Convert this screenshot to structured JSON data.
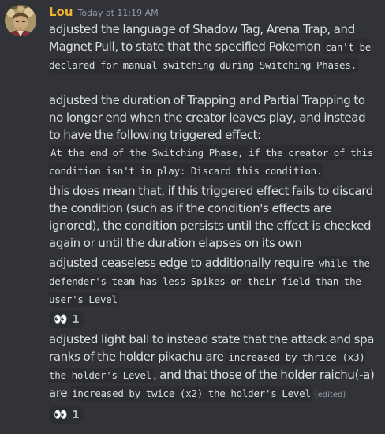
{
  "message": {
    "author": "Lou",
    "timestamp": "Today at 11:19 AM",
    "author_color": "#f0b232",
    "avatar_icon": "character-portrait-avatar"
  },
  "blocks": {
    "b1": {
      "t1": "adjusted the language of Shadow Tag, Arena Trap, and Magnet Pull, to state that the specified Pokemon ",
      "c1": "can't be declared for manual switching during Switching Phases."
    },
    "b2": {
      "t1": "adjusted the duration of Trapping and Partial Trapping to no longer end when the creator leaves play, and instead to have the following triggered effect:",
      "c1": "At the end of the Switching Phase, if the creator of this condition isn't in play: Discard this condition."
    },
    "b3": {
      "t1": "this does mean that, if this triggered effect fails to discard the condition (such as if the condition's effects are ignored), the condition persists until the effect is checked again or until the duration elapses on its own"
    },
    "b4": {
      "t1": "adjusted ceaseless edge to additionally require ",
      "c1": "while the defender's team has less Spikes on their field than the user's Level"
    },
    "b5": {
      "t1": "adjusted light ball to instead state that the attack and spa ranks of the holder pikachu are ",
      "c1": "increased by thrice (x3) the holder's Level",
      "t2": ", and that those of the holder raichu(-a) are ",
      "c2": "increased by twice (x2) the holder's Level",
      "edited": "(edited)"
    }
  },
  "reactions": [
    {
      "emoji": "👀",
      "emoji_icon": "eyes-emoji",
      "count": "1"
    },
    {
      "emoji": "👀",
      "emoji_icon": "eyes-emoji",
      "count": "1"
    }
  ]
}
